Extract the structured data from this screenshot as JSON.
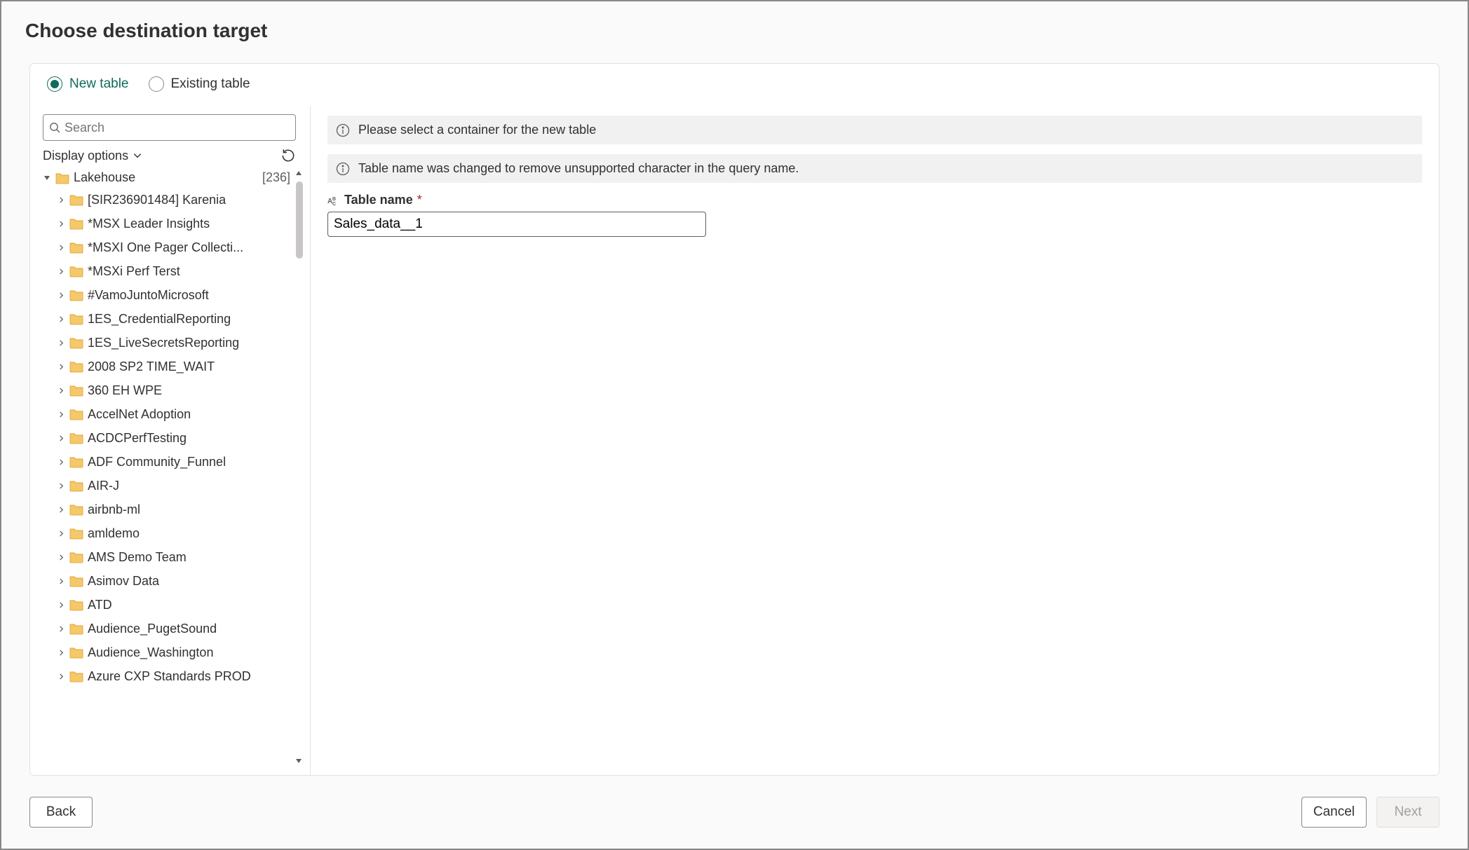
{
  "header": {
    "title": "Choose destination target"
  },
  "tabs": {
    "new_table": "New table",
    "existing_table": "Existing table"
  },
  "sidebar": {
    "search_placeholder": "Search",
    "display_options": "Display options",
    "root": {
      "label": "Lakehouse",
      "count": "[236]"
    },
    "items": [
      {
        "label": "[SIR236901484] Karenia"
      },
      {
        "label": "*MSX Leader Insights"
      },
      {
        "label": "*MSXI One Pager Collecti..."
      },
      {
        "label": "*MSXi Perf Terst"
      },
      {
        "label": "#VamoJuntoMicrosoft"
      },
      {
        "label": "1ES_CredentialReporting"
      },
      {
        "label": "1ES_LiveSecretsReporting"
      },
      {
        "label": "2008 SP2 TIME_WAIT"
      },
      {
        "label": "360 EH WPE"
      },
      {
        "label": "AccelNet Adoption"
      },
      {
        "label": "ACDCPerfTesting"
      },
      {
        "label": "ADF Community_Funnel"
      },
      {
        "label": "AIR-J"
      },
      {
        "label": "airbnb-ml"
      },
      {
        "label": "amldemo"
      },
      {
        "label": "AMS Demo Team"
      },
      {
        "label": "Asimov Data"
      },
      {
        "label": "ATD"
      },
      {
        "label": "Audience_PugetSound"
      },
      {
        "label": "Audience_Washington"
      },
      {
        "label": "Azure CXP Standards PROD"
      }
    ]
  },
  "messages": {
    "select_container": "Please select a container for the new table",
    "name_changed": "Table name was changed to remove unsupported character in the query name."
  },
  "form": {
    "table_name_label": "Table name",
    "table_name_value": "Sales_data__1"
  },
  "footer": {
    "back": "Back",
    "cancel": "Cancel",
    "next": "Next"
  }
}
